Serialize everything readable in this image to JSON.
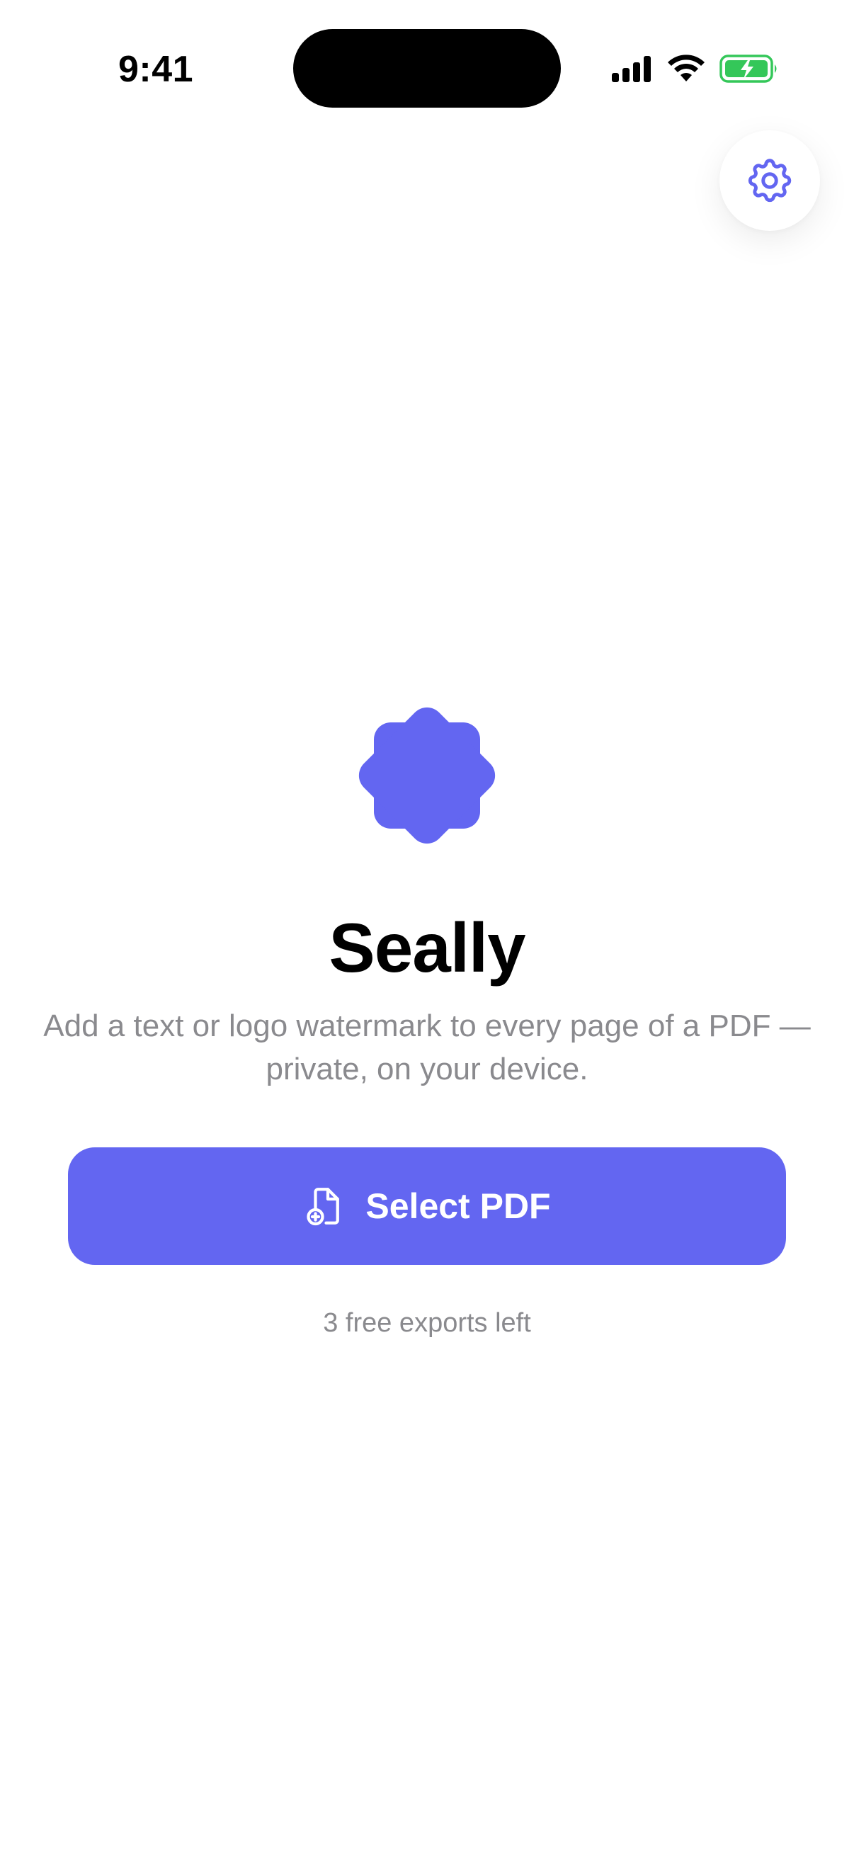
{
  "status_bar": {
    "time": "9:41"
  },
  "icons": {
    "signal": "cellular-signal-icon",
    "wifi": "wifi-icon",
    "battery": "battery-charging-icon",
    "settings": "gear-icon",
    "logo": "badge-icon",
    "select_pdf": "document-add-icon"
  },
  "colors": {
    "accent": "#6366f1",
    "battery_fill": "#34c759",
    "secondary_text": "#8a8a8e"
  },
  "hero": {
    "title": "Seally",
    "subtitle": "Add a text or logo watermark to every page of a PDF — private, on your device."
  },
  "actions": {
    "select_pdf_label": "Select PDF"
  },
  "footer": {
    "exports_left": "3 free exports left"
  }
}
